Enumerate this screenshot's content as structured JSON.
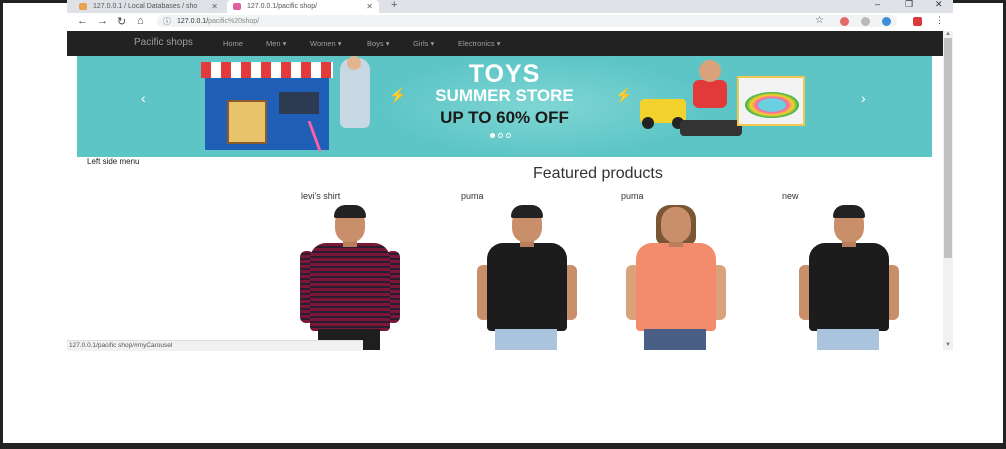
{
  "browser": {
    "tabs": [
      {
        "title": "127.0.0.1 / Local Databases / sho",
        "active": false
      },
      {
        "title": "127.0.0.1/pacific shop/",
        "active": true
      }
    ],
    "new_tab": "+",
    "address": {
      "host": "127.0.0.1/",
      "path": "pacific%20shop/"
    },
    "status_url": "127.0.0.1/pacific shop/#myCarousel"
  },
  "navbar": {
    "brand": "Pacific shops",
    "items": [
      "Home",
      "Men ▾",
      "Women ▾",
      "Boys ▾",
      "Girls ▾",
      "Electronics ▾"
    ]
  },
  "banner": {
    "line1": "TOYS",
    "line2": "SUMMER STORE",
    "line3": "UP TO 60% OFF",
    "prev": "‹",
    "next": "›",
    "active_slide": 1,
    "slide_count": 3
  },
  "sidebar": {
    "label": "Left side menu"
  },
  "featured": {
    "heading": "Featured products",
    "products": [
      {
        "name": "levi's shirt"
      },
      {
        "name": "puma"
      },
      {
        "name": "puma"
      },
      {
        "name": "new"
      }
    ]
  },
  "colors": {
    "navbar": "#222222",
    "banner": "#5ec5c6"
  }
}
